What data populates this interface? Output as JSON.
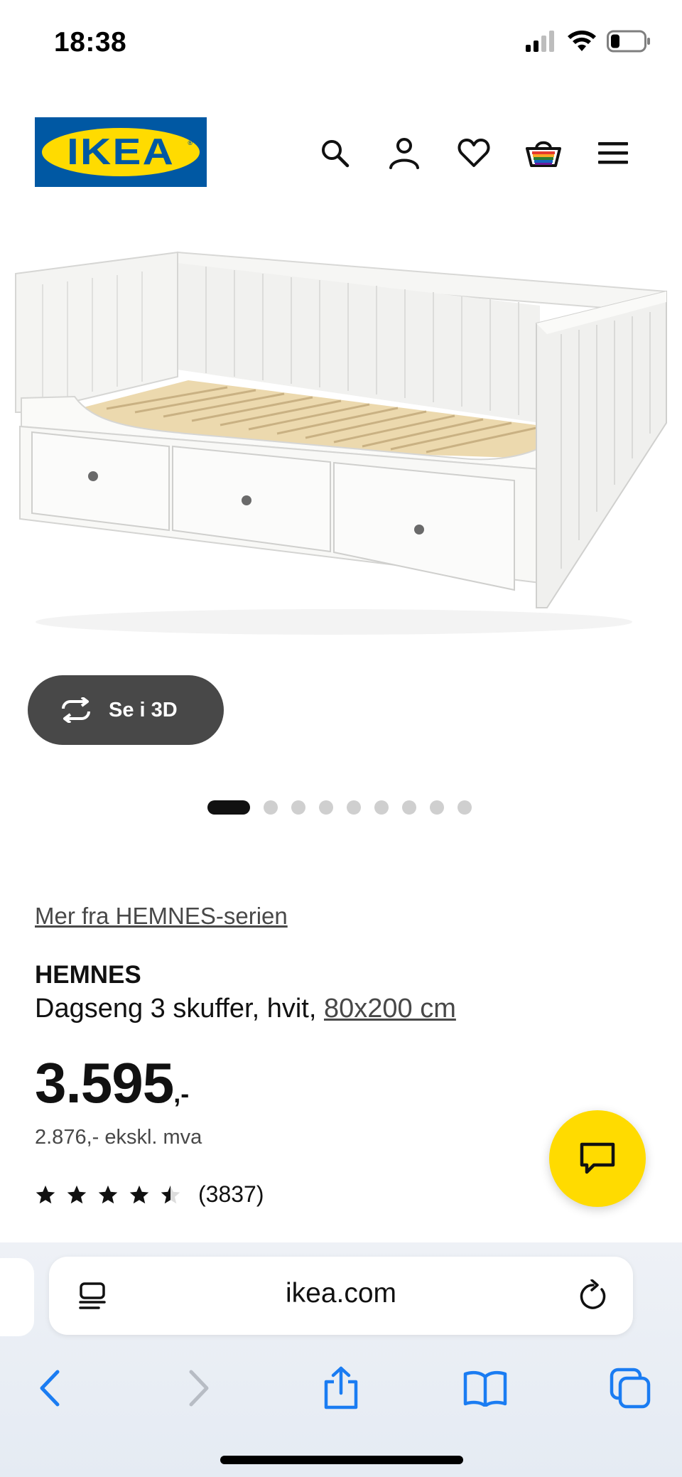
{
  "status_bar": {
    "time": "18:38"
  },
  "header": {
    "logo_text": "IKEA",
    "icons": [
      "search-icon",
      "account-icon",
      "heart-icon",
      "basket-icon",
      "menu-icon"
    ]
  },
  "product_image": {
    "button_3d_label": "Se i 3D",
    "carousel_dots_total": 10,
    "carousel_active_index": 0
  },
  "product": {
    "series_link": "Mer fra HEMNES-serien",
    "name": "HEMNES",
    "description": "Dagseng 3 skuffer, hvit, ",
    "size": "80x200 cm",
    "price": "3.595",
    "price_suffix": ",-",
    "price_ex_vat": "2.876,- ekskl. mva",
    "rating": 4.5,
    "rating_count": "(3837)"
  },
  "browser": {
    "url": "ikea.com",
    "icons": [
      "reader-icon",
      "reload-icon",
      "back-icon",
      "forward-icon",
      "share-icon",
      "bookmarks-icon",
      "tabs-icon"
    ]
  },
  "colors": {
    "ikea_blue": "#0058a3",
    "ikea_yellow": "#ffdb00",
    "safari_blue": "#1a7cf2"
  }
}
